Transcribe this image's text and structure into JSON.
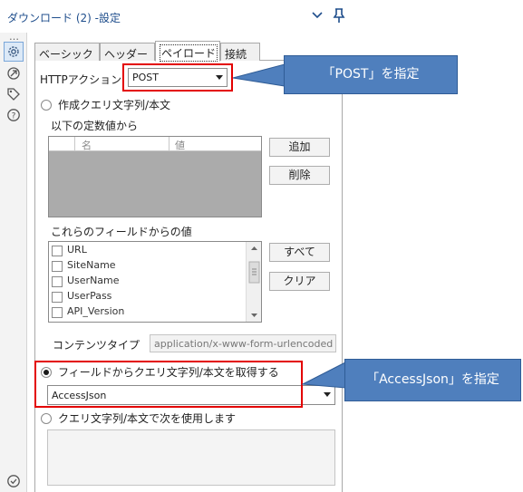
{
  "window": {
    "title": "ダウンロード (2) -設定",
    "more_dots": "…"
  },
  "rail": {
    "items": [
      {
        "icon": "gear-icon"
      },
      {
        "icon": "arrow-circle-icon"
      },
      {
        "icon": "tag-icon"
      },
      {
        "icon": "help-icon"
      }
    ],
    "bottom_icon": "check-circle-icon"
  },
  "tabs": [
    {
      "label": "ベーシック",
      "active": false
    },
    {
      "label": "ヘッダー",
      "active": false
    },
    {
      "label": "ペイロード",
      "active": true
    },
    {
      "label": "接続",
      "active": false
    }
  ],
  "payload": {
    "http_action_label": "HTTPアクション",
    "http_action_value": "POST",
    "option_compose_label": "作成クエリ文字列/本文",
    "constants_label": "以下の定数値から",
    "constants_columns": [
      "名",
      "値"
    ],
    "add_button": "追加",
    "delete_button": "削除",
    "fields_label": "これらのフィールドからの値",
    "fields": [
      "URL",
      "SiteName",
      "UserName",
      "UserPass",
      "API_Version"
    ],
    "all_button": "すべて",
    "clear_button": "クリア",
    "content_type_label": "コンテンツタイプ",
    "content_type_value": "application/x-www-form-urlencoded",
    "option_from_field_label": "フィールドからクエリ文字列/本文を取得する",
    "field_select_value": "AccessJson",
    "option_use_following_label": "クエリ文字列/本文で次を使用します"
  },
  "annotations": {
    "post_callout": "「POST」を指定",
    "accessjson_callout": "「AccessJson」を指定"
  }
}
